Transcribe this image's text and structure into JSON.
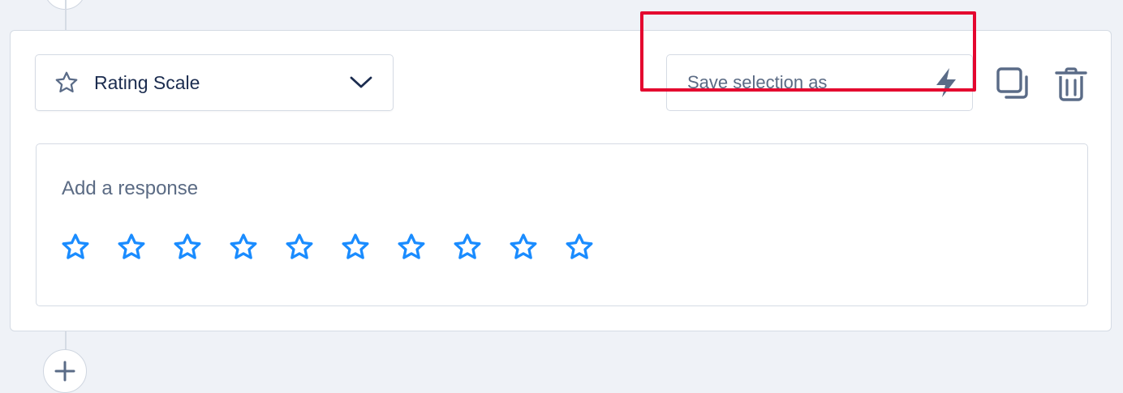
{
  "question_type": {
    "label": "Rating Scale",
    "icon": "star-outline-icon"
  },
  "save_selection": {
    "placeholder": "Save selection as",
    "value": "",
    "icon": "lightning-bolt-icon"
  },
  "actions": {
    "copy_icon": "duplicate-icon",
    "delete_icon": "trash-icon"
  },
  "response": {
    "label": "Add a response",
    "star_count": 10,
    "star_color": "#1a8cff"
  },
  "colors": {
    "accent_star": "#1a8cff",
    "highlight": "#e4072f",
    "icon": "#5a6b87",
    "text_dark": "#1b2c4f"
  },
  "add_button_icon": "plus-icon"
}
